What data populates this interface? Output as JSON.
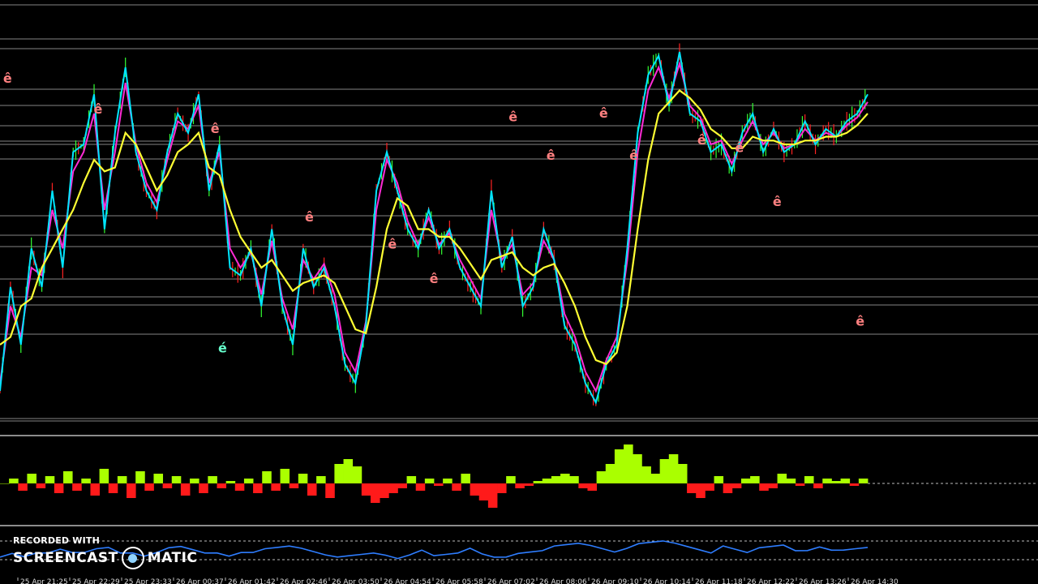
{
  "watermark": {
    "recorded_with": "RECORDED WITH",
    "brand_left": "SCREENCAST",
    "brand_right": "MATIC",
    "icon": "screencast-o-matic-logo"
  },
  "time_axis_labels": [
    "25 Apr 21:25",
    "25 Apr 22:29",
    "25 Apr 23:33",
    "26 Apr 00:37",
    "26 Apr 01:42",
    "26 Apr 02:46",
    "26 Apr 03:50",
    "26 Apr 04:54",
    "26 Apr 05:58",
    "26 Apr 07:02",
    "26 Apr 08:06",
    "26 Apr 09:10",
    "26 Apr 10:14",
    "26 Apr 11:18",
    "26 Apr 12:22",
    "26 Apr 13:26",
    "26 Apr 14:30"
  ],
  "signal_marker_glyphs": {
    "sell": "ê",
    "buy": "é"
  },
  "colors": {
    "background": "#000000",
    "fast_line": "#00e5ff",
    "mid_line": "#ff2bd6",
    "slow_line": "#ffff33",
    "candle_up": "#33ff33",
    "candle_down": "#ff2222",
    "histogram_up": "#aaff00",
    "histogram_down": "#ff1a1a",
    "oscillator": "#2e7dff",
    "sell_marker": "#ff8080",
    "buy_marker": "#66ffcc",
    "level_line": "#cfcfcf"
  },
  "chart_data": [
    {
      "type": "line",
      "name": "price-panel",
      "x": [
        0,
        2,
        4,
        6,
        8,
        10,
        12,
        14,
        16,
        18,
        20,
        22,
        24,
        26,
        28,
        30,
        32,
        34,
        36,
        38,
        40,
        42,
        44,
        46,
        48,
        50,
        52,
        54,
        56,
        58,
        60,
        62,
        64,
        66,
        68,
        70,
        72,
        74,
        76,
        78,
        80,
        82,
        84,
        86,
        88,
        90,
        92,
        94,
        96,
        98,
        100,
        102,
        104,
        106,
        108,
        110,
        112,
        114,
        116,
        118,
        120,
        122,
        124,
        126,
        128,
        130,
        132,
        134,
        136,
        138,
        140,
        142,
        144,
        146,
        148,
        150,
        152,
        154,
        156,
        158,
        160,
        162,
        164,
        166
      ],
      "fast": [
        8,
        35,
        20,
        45,
        35,
        60,
        40,
        70,
        72,
        85,
        50,
        75,
        92,
        70,
        60,
        55,
        70,
        80,
        75,
        85,
        60,
        72,
        40,
        38,
        45,
        30,
        50,
        30,
        20,
        45,
        35,
        40,
        30,
        15,
        10,
        25,
        60,
        70,
        60,
        50,
        45,
        55,
        45,
        50,
        40,
        35,
        30,
        60,
        40,
        48,
        30,
        35,
        50,
        42,
        25,
        20,
        10,
        5,
        15,
        20,
        45,
        75,
        90,
        95,
        82,
        96,
        80,
        78,
        70,
        72,
        65,
        75,
        80,
        70,
        76,
        70,
        72,
        78,
        72,
        76,
        74,
        78,
        80,
        85
      ],
      "mid": [
        10,
        30,
        22,
        40,
        38,
        55,
        45,
        65,
        70,
        80,
        55,
        70,
        88,
        72,
        62,
        57,
        68,
        78,
        76,
        82,
        62,
        70,
        45,
        40,
        44,
        33,
        47,
        32,
        24,
        42,
        37,
        41,
        33,
        18,
        13,
        26,
        55,
        68,
        62,
        52,
        46,
        53,
        46,
        49,
        42,
        37,
        32,
        55,
        42,
        46,
        33,
        36,
        47,
        42,
        28,
        22,
        13,
        8,
        16,
        22,
        42,
        70,
        86,
        92,
        84,
        93,
        82,
        79,
        72,
        73,
        67,
        73,
        78,
        72,
        75,
        71,
        72,
        76,
        73,
        75,
        74,
        77,
        79,
        83
      ],
      "slow": [
        20,
        22,
        30,
        32,
        40,
        45,
        50,
        55,
        62,
        68,
        65,
        66,
        75,
        72,
        66,
        60,
        64,
        70,
        72,
        75,
        66,
        64,
        55,
        48,
        44,
        40,
        42,
        38,
        34,
        36,
        37,
        38,
        36,
        30,
        24,
        23,
        35,
        50,
        58,
        56,
        50,
        50,
        48,
        48,
        45,
        41,
        37,
        42,
        43,
        44,
        40,
        38,
        40,
        41,
        36,
        30,
        22,
        16,
        15,
        18,
        30,
        50,
        68,
        80,
        83,
        86,
        84,
        81,
        76,
        74,
        71,
        71,
        74,
        73,
        73,
        72,
        72,
        73,
        73,
        74,
        74,
        75,
        77,
        80
      ],
      "ylim": [
        0,
        100
      ],
      "horizontal_levels": 21,
      "sell_signals": [
        [
          2,
          88
        ],
        [
          26,
          80
        ],
        [
          57,
          75
        ],
        [
          82,
          52
        ],
        [
          104,
          45
        ],
        [
          115,
          36
        ],
        [
          136,
          78
        ],
        [
          146,
          68
        ],
        [
          160,
          79
        ],
        [
          168,
          68
        ],
        [
          186,
          72
        ],
        [
          196,
          70
        ],
        [
          206,
          56
        ],
        [
          228,
          25
        ]
      ],
      "buy_signals": [
        [
          59,
          18
        ]
      ]
    },
    {
      "type": "bar",
      "name": "histogram-panel",
      "values": [
        0,
        2,
        -3,
        4,
        -2,
        3,
        -4,
        5,
        -3,
        2,
        -5,
        6,
        -4,
        3,
        -6,
        5,
        -3,
        4,
        -2,
        3,
        -5,
        2,
        -4,
        3,
        -2,
        1,
        -3,
        2,
        -4,
        5,
        -3,
        6,
        -2,
        4,
        -5,
        3,
        -6,
        8,
        10,
        7,
        -5,
        -8,
        -6,
        -4,
        -2,
        3,
        -3,
        2,
        -1,
        2,
        -3,
        4,
        -5,
        -7,
        -10,
        -4,
        3,
        -2,
        -1,
        1,
        2,
        3,
        4,
        3,
        -2,
        -3,
        5,
        8,
        14,
        16,
        12,
        7,
        4,
        10,
        12,
        8,
        -4,
        -6,
        -3,
        3,
        -4,
        -2,
        2,
        3,
        -3,
        -2,
        4,
        2,
        -1,
        3,
        -2,
        2,
        1,
        2,
        -1,
        2
      ],
      "ylim": [
        -16,
        16
      ]
    },
    {
      "type": "line",
      "name": "oscillator-panel",
      "values": [
        4,
        6,
        5,
        7,
        6,
        8,
        7,
        6,
        8,
        9,
        7,
        6,
        5,
        7,
        8,
        9,
        8,
        7,
        6,
        5,
        7,
        6,
        8,
        9,
        10,
        8,
        7,
        6,
        4,
        5,
        6,
        7,
        5,
        4,
        6,
        7,
        5,
        6,
        7,
        8,
        6,
        5,
        4,
        6,
        7,
        8,
        9,
        10,
        11,
        9,
        8,
        7,
        9,
        10,
        11,
        12,
        10,
        9,
        8,
        7,
        9,
        8,
        7,
        8,
        9,
        10,
        8,
        7,
        9,
        8,
        7,
        8,
        9
      ],
      "ylim": [
        0,
        14
      ]
    }
  ]
}
